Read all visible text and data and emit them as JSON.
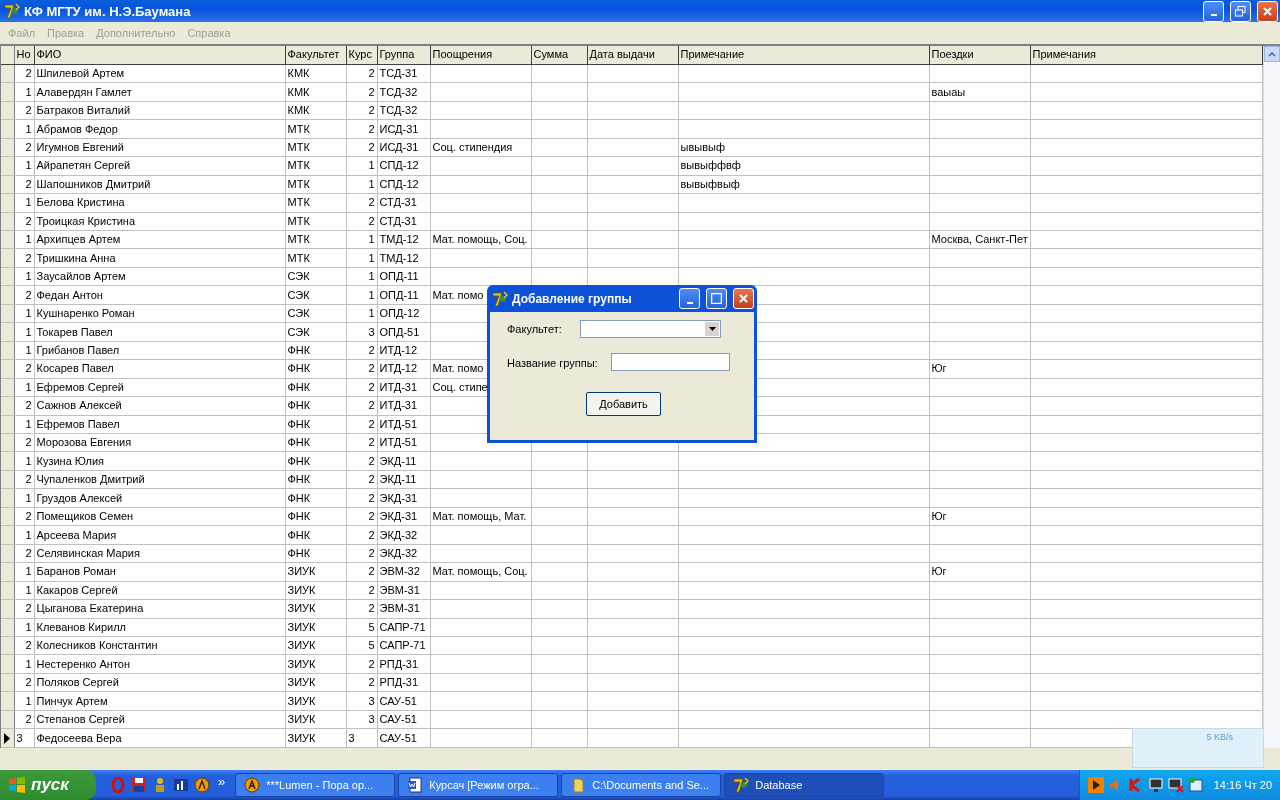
{
  "window": {
    "title": "КФ МГТУ им. Н.Э.Баумана"
  },
  "menu": [
    "Файл",
    "Правка",
    "Дополнительно",
    "Справка"
  ],
  "table": {
    "columns": [
      "Но",
      "ФИО",
      "Факультет",
      "Курс",
      "Группа",
      "Поощрения",
      "Сумма",
      "Дата выдачи",
      "Примечание",
      "Поездки",
      "Примечания"
    ],
    "rows": [
      {
        "selected": false,
        "number": "2",
        "name": "Шпилевой Артем",
        "faculty": "КМК",
        "course": "2",
        "group": "ТСД-31"
      },
      {
        "selected": false,
        "number": "1",
        "name": "Алавердян Гамлет",
        "faculty": "КМК",
        "course": "2",
        "group": "ТСД-32",
        "trips": "ваыаы"
      },
      {
        "selected": false,
        "number": "2",
        "name": "Батраков Виталий",
        "faculty": "КМК",
        "course": "2",
        "group": "ТСД-32"
      },
      {
        "selected": false,
        "number": "1",
        "name": "Абрамов Федор",
        "faculty": "МТК",
        "course": "2",
        "group": "ИСД-31"
      },
      {
        "selected": false,
        "number": "2",
        "name": "Игумнов Евгений",
        "faculty": "МТК",
        "course": "2",
        "group": "ИСД-31",
        "rewards": "Соц. стипендия",
        "note": "ывывыф"
      },
      {
        "selected": false,
        "number": "1",
        "name": "Айрапетян Сергей",
        "faculty": "МТК",
        "course": "1",
        "group": "СПД-12",
        "note": "вывыффвф"
      },
      {
        "selected": false,
        "number": "2",
        "name": "Шапошников Дмитрий",
        "faculty": "МТК",
        "course": "1",
        "group": "СПД-12",
        "note": "вывыфвыф"
      },
      {
        "selected": false,
        "number": "1",
        "name": "Белова Кристина",
        "faculty": "МТК",
        "course": "2",
        "group": "СТД-31"
      },
      {
        "selected": false,
        "number": "2",
        "name": "Троицкая Кристина",
        "faculty": "МТК",
        "course": "2",
        "group": "СТД-31"
      },
      {
        "selected": false,
        "number": "1",
        "name": "Архипцев Артем",
        "faculty": "МТК",
        "course": "1",
        "group": "ТМД-12",
        "rewards": "Мат. помощь, Соц.",
        "trips": "Москва, Санкт-Пет"
      },
      {
        "selected": false,
        "number": "2",
        "name": "Тришкина Анна",
        "faculty": "МТК",
        "course": "1",
        "group": "ТМД-12"
      },
      {
        "selected": false,
        "number": "1",
        "name": "Заусайлов Артем",
        "faculty": "СЭК",
        "course": "1",
        "group": "ОПД-11"
      },
      {
        "selected": false,
        "number": "2",
        "name": "Федан Антон",
        "faculty": "СЭК",
        "course": "1",
        "group": "ОПД-11",
        "rewards": "Мат. помо"
      },
      {
        "selected": false,
        "number": "1",
        "name": "Кушнаренко Роман",
        "faculty": "СЭК",
        "course": "1",
        "group": "ОПД-12"
      },
      {
        "selected": false,
        "number": "1",
        "name": "Токарев Павел",
        "faculty": "СЭК",
        "course": "3",
        "group": "ОПД-51"
      },
      {
        "selected": false,
        "number": "1",
        "name": "Грибанов Павел",
        "faculty": "ФНК",
        "course": "2",
        "group": "ИТД-12"
      },
      {
        "selected": false,
        "number": "2",
        "name": "Косарев Павел",
        "faculty": "ФНК",
        "course": "2",
        "group": "ИТД-12",
        "rewards": "Мат. помо",
        "trips": "Юг"
      },
      {
        "selected": false,
        "number": "1",
        "name": "Ефремов Сергей",
        "faculty": "ФНК",
        "course": "2",
        "group": "ИТД-31",
        "rewards": "Соц. стипе"
      },
      {
        "selected": false,
        "number": "2",
        "name": "Сажнов Алексей",
        "faculty": "ФНК",
        "course": "2",
        "group": "ИТД-31"
      },
      {
        "selected": false,
        "number": "1",
        "name": "Ефремов Павел",
        "faculty": "ФНК",
        "course": "2",
        "group": "ИТД-51"
      },
      {
        "selected": false,
        "number": "2",
        "name": "Морозова Евгения",
        "faculty": "ФНК",
        "course": "2",
        "group": "ИТД-51"
      },
      {
        "selected": false,
        "number": "1",
        "name": "Кузина Юлия",
        "faculty": "ФНК",
        "course": "2",
        "group": "ЭКД-11"
      },
      {
        "selected": false,
        "number": "2",
        "name": "Чупаленков Дмитрий",
        "faculty": "ФНК",
        "course": "2",
        "group": "ЭКД-11"
      },
      {
        "selected": false,
        "number": "1",
        "name": "Груздов Алексей",
        "faculty": "ФНК",
        "course": "2",
        "group": "ЭКД-31"
      },
      {
        "selected": false,
        "number": "2",
        "name": "Помещиков Семен",
        "faculty": "ФНК",
        "course": "2",
        "group": "ЭКД-31",
        "rewards": "Мат. помощь, Мат.",
        "trips": "Юг"
      },
      {
        "selected": false,
        "number": "1",
        "name": "Арсеева Мария",
        "faculty": "ФНК",
        "course": "2",
        "group": "ЭКД-32"
      },
      {
        "selected": false,
        "number": "2",
        "name": "Селявинская Мария",
        "faculty": "ФНК",
        "course": "2",
        "group": "ЭКД-32"
      },
      {
        "selected": false,
        "number": "1",
        "name": "Баранов Роман",
        "faculty": "ЗИУК",
        "course": "2",
        "group": "ЭВМ-32",
        "rewards": "Мат. помощь, Соц.",
        "trips": "Юг"
      },
      {
        "selected": false,
        "number": "1",
        "name": "Какаров Сергей",
        "faculty": "ЗИУК",
        "course": "2",
        "group": "ЭВМ-31"
      },
      {
        "selected": false,
        "number": "2",
        "name": "Цыганова Екатерина",
        "faculty": "ЗИУК",
        "course": "2",
        "group": "ЭВМ-31"
      },
      {
        "selected": false,
        "number": "1",
        "name": "Клеванов Кирилл",
        "faculty": "ЗИУК",
        "course": "5",
        "group": "САПР-71"
      },
      {
        "selected": false,
        "number": "2",
        "name": "Колесников Константин",
        "faculty": "ЗИУК",
        "course": "5",
        "group": "САПР-71"
      },
      {
        "selected": false,
        "number": "1",
        "name": "Нестеренко Антон",
        "faculty": "ЗИУК",
        "course": "2",
        "group": "РПД-31"
      },
      {
        "selected": false,
        "number": "2",
        "name": "Поляков Сергей",
        "faculty": "ЗИУК",
        "course": "2",
        "group": "РПД-31"
      },
      {
        "selected": false,
        "number": "1",
        "name": "Пинчук Артем",
        "faculty": "ЗИУК",
        "course": "3",
        "group": "САУ-51"
      },
      {
        "selected": false,
        "number": "2",
        "name": "Степанов Сергей",
        "faculty": "ЗИУК",
        "course": "3",
        "group": "САУ-51"
      },
      {
        "selected": true,
        "number": "3",
        "name": "Федосеева Вера",
        "faculty": "ЗИУК",
        "course": "3",
        "group": "САУ-51"
      }
    ]
  },
  "dialog": {
    "title": "Добавление группы",
    "faculty_label": "Факультет:",
    "group_label": "Название группы:",
    "add_button": "Добавить"
  },
  "net_widget": {
    "speed": "5 KB/s"
  },
  "taskbar": {
    "start": "пуск",
    "more": "»",
    "tasks": [
      {
        "label": "***Lumen - Пора ор...",
        "selected": false
      },
      {
        "label": "Курсач [Режим огра...",
        "selected": false
      },
      {
        "label": "C:\\Documents and Se...",
        "selected": false
      },
      {
        "label": "Database",
        "selected": true
      }
    ],
    "clock": "14:16 Чт 20"
  }
}
